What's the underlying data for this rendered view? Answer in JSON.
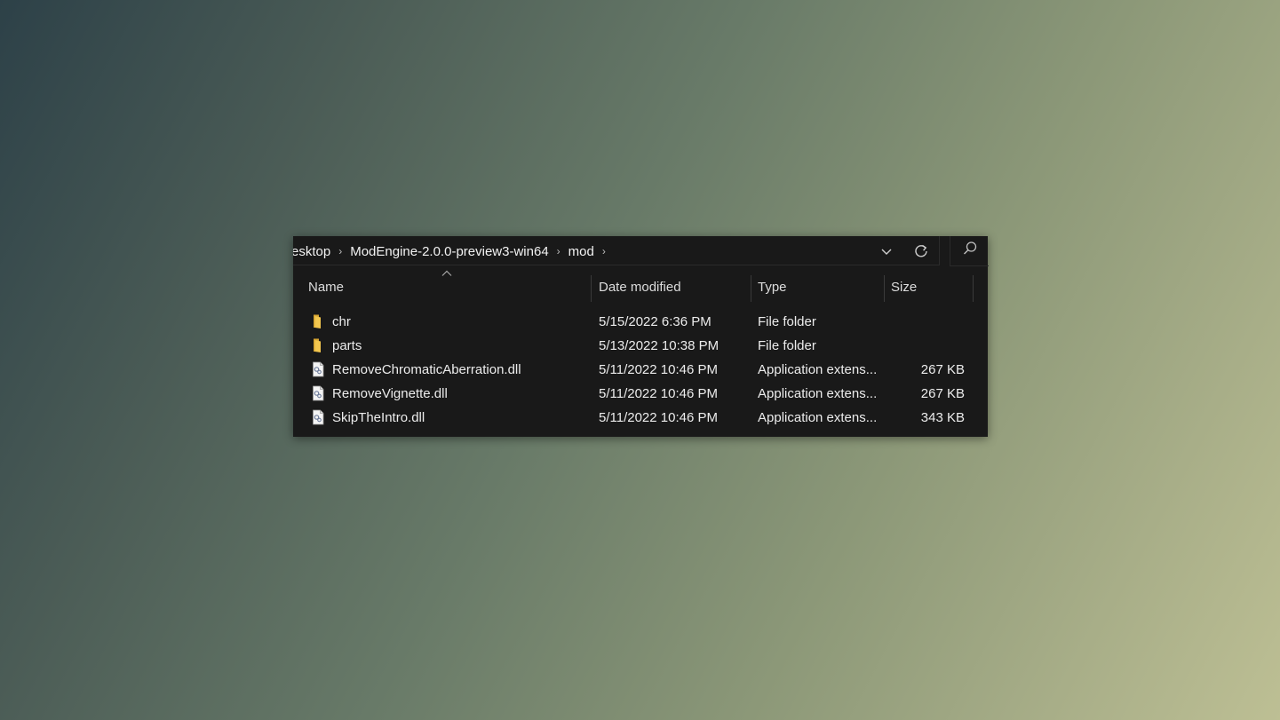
{
  "breadcrumb": {
    "items": [
      "esktop",
      "ModEngine-2.0.0-preview3-win64",
      "mod"
    ]
  },
  "address_bar": {
    "dropdown_icon": "chevron-down-icon",
    "refresh_icon": "refresh-icon",
    "search_icon": "search-icon"
  },
  "columns": {
    "name": "Name",
    "date": "Date modified",
    "type": "Type",
    "size": "Size"
  },
  "files": [
    {
      "name": "chr",
      "date": "5/15/2022 6:36 PM",
      "type": "File folder",
      "size": "",
      "icon": "folder-icon"
    },
    {
      "name": "parts",
      "date": "5/13/2022 10:38 PM",
      "type": "File folder",
      "size": "",
      "icon": "folder-icon"
    },
    {
      "name": "RemoveChromaticAberration.dll",
      "date": "5/11/2022 10:46 PM",
      "type": "Application extens...",
      "size": "267 KB",
      "icon": "dll-file-icon"
    },
    {
      "name": "RemoveVignette.dll",
      "date": "5/11/2022 10:46 PM",
      "type": "Application extens...",
      "size": "267 KB",
      "icon": "dll-file-icon"
    },
    {
      "name": "SkipTheIntro.dll",
      "date": "5/11/2022 10:46 PM",
      "type": "Application extens...",
      "size": "343 KB",
      "icon": "dll-file-icon"
    }
  ],
  "colors": {
    "window_bg": "#191919",
    "folder": "#e8b73c",
    "text": "#ffffff"
  }
}
